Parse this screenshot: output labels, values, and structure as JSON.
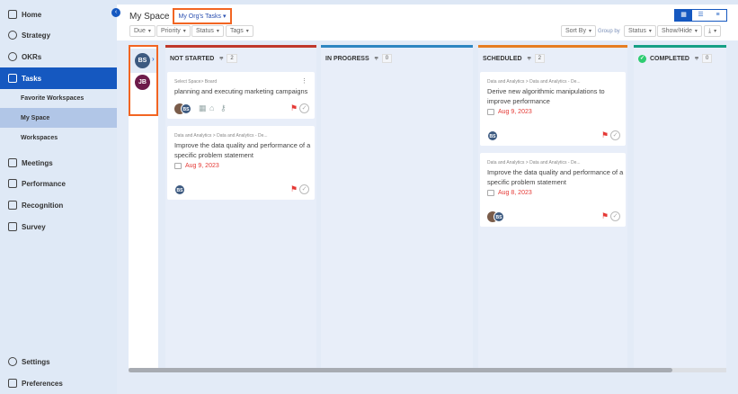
{
  "sidebar": {
    "items": [
      {
        "label": "Home",
        "icon": "home-icon"
      },
      {
        "label": "Strategy",
        "icon": "bulb-icon"
      },
      {
        "label": "OKRs",
        "icon": "target-icon"
      },
      {
        "label": "Tasks",
        "icon": "calendar-check-icon"
      },
      {
        "label": "Meetings",
        "icon": "calendar-icon"
      },
      {
        "label": "Performance",
        "icon": "chart-icon"
      },
      {
        "label": "Recognition",
        "icon": "award-icon"
      },
      {
        "label": "Survey",
        "icon": "list-icon"
      }
    ],
    "subitems": [
      "Favorite Workspaces",
      "My Space",
      "Workspaces"
    ],
    "bottom": [
      {
        "label": "Settings",
        "icon": "gear-icon"
      },
      {
        "label": "Preferences",
        "icon": "sliders-icon"
      }
    ]
  },
  "header": {
    "title": "My Space",
    "scope": "My Org's Tasks",
    "filters": [
      "Due",
      "Priority",
      "Status",
      "Tags"
    ],
    "sort_by": "Sort By",
    "group_by_label": "Group by",
    "group_by": "Status",
    "show_hide": "Show/Hide"
  },
  "users": [
    "BS",
    "JB"
  ],
  "columns": [
    {
      "name": "NOT STARTED",
      "count": "2",
      "color": "#c0392b",
      "cards": [
        {
          "breadcrumb": "Select Space> Board",
          "title": "planning and executing marketing campaigns",
          "date": null,
          "avatars": [
            "photo",
            "BS"
          ]
        },
        {
          "breadcrumb": "Data and Analytics > Data and Analytics - De...",
          "title": "Improve the data quality and performance of a specific problem statement",
          "date": "Aug 9, 2023",
          "avatars": [
            "BS"
          ]
        }
      ]
    },
    {
      "name": "IN PROGRESS",
      "count": "0",
      "color": "#2e86c1",
      "cards": []
    },
    {
      "name": "SCHEDULED",
      "count": "2",
      "color": "#e67e22",
      "cards": [
        {
          "breadcrumb": "Data and Analytics > Data and Analytics - De...",
          "title": "Derive new algorithmic manipulations to improve performance",
          "date": "Aug 9, 2023",
          "avatars": [
            "BS"
          ]
        },
        {
          "breadcrumb": "Data and Analytics > Data and Analytics - De...",
          "title": "Improve the data quality and performance of a specific problem statement",
          "date": "Aug 8, 2023",
          "avatars": [
            "photo",
            "BS"
          ]
        }
      ]
    },
    {
      "name": "COMPLETED",
      "count": "0",
      "color": "#16a085",
      "cards": []
    }
  ]
}
